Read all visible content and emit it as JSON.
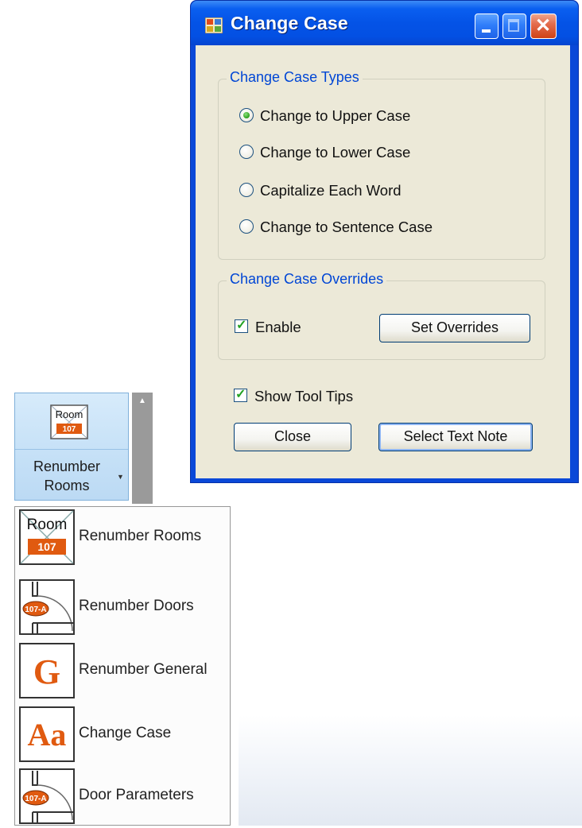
{
  "dialog": {
    "title": "Change Case",
    "types_group": {
      "legend": "Change Case Types",
      "options": [
        {
          "label": "Change to Upper Case",
          "selected": true
        },
        {
          "label": "Change to Lower Case",
          "selected": false
        },
        {
          "label": "Capitalize Each Word",
          "selected": false
        },
        {
          "label": "Change to Sentence Case",
          "selected": false
        }
      ]
    },
    "overrides_group": {
      "legend": "Change Case Overrides",
      "enable_label": "Enable",
      "enable_checked": true,
      "set_overrides_label": "Set Overrides"
    },
    "show_tool_tips_label": "Show Tool Tips",
    "show_tool_tips_checked": true,
    "close_label": "Close",
    "select_text_note_label": "Select Text Note"
  },
  "ribbon": {
    "button_label": "Renumber\nRooms",
    "icon_text_top": "Room",
    "icon_text_bottom": "107"
  },
  "menu": {
    "items": [
      {
        "label": "Renumber Rooms",
        "icon": "room-107-icon"
      },
      {
        "label": "Renumber Doors",
        "icon": "door-107a-icon"
      },
      {
        "label": "Renumber General",
        "icon": "g-letter-icon"
      },
      {
        "label": "Change Case",
        "icon": "aa-letters-icon"
      },
      {
        "label": "Door Parameters",
        "icon": "door-107a-icon"
      }
    ],
    "door_tag_text": "107-A",
    "general_letter": "G",
    "case_letters": "Aa"
  },
  "colors": {
    "title_bar": "#0453e6",
    "legend_text": "#0046d5",
    "dialog_face": "#ece9d8",
    "ribbon_highlight": "#c6e1f7",
    "tag_orange": "#e05a10"
  }
}
